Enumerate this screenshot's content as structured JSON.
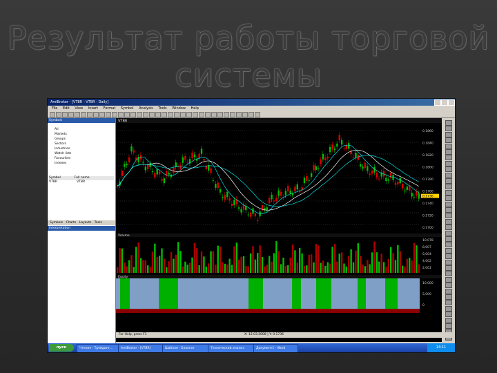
{
  "slide": {
    "title_line1": "Результат работы торговой",
    "title_line2": "системы"
  },
  "window": {
    "title": "AmiBroker - [VTBR - VTBR - Daily]",
    "menu": [
      "File",
      "Edit",
      "View",
      "Insert",
      "Format",
      "Symbol",
      "Analysis",
      "Tools",
      "Window",
      "Help"
    ]
  },
  "left_panel": {
    "header": "Symbols",
    "tree": [
      "All",
      "Markets",
      "Groups",
      "Sectors",
      "Industries",
      "Watch lists",
      "Favourites",
      "Indexes"
    ],
    "symbol_header": [
      "Symbol",
      "Full name"
    ],
    "symbol_row": [
      "VTBR",
      "VTBR"
    ],
    "tabs": [
      "Symbols",
      "Charts",
      "Layouts",
      "Tools"
    ],
    "lower_header": "Interpretation"
  },
  "chart": {
    "pane_label": "VTBR",
    "price_ticks": [
      "0.1860",
      "0.1840",
      "0.1820",
      "0.1800",
      "0.1780",
      "0.1760",
      "0.1740",
      "0.1720",
      "0.1700"
    ],
    "price_last": "0.1736",
    "volume_label": "Volume",
    "volume_ticks": [
      "10,078",
      "8,007",
      "6,004",
      "4,002",
      "2,001"
    ],
    "equity_label": "Equity",
    "equity_ticks": [
      "10,000",
      "5,000",
      "0"
    ],
    "colors": {
      "bull": "#00c000",
      "bear": "#e00000",
      "ma_fast": "#00e0e0",
      "ma_slow": "#ffffff",
      "equity_fill": "#7f9fc7",
      "signal": "#00b000"
    }
  },
  "status": {
    "text": "For Help, press F1",
    "coords": "X: 12.03.2008 | Y: 0.1736"
  },
  "taskbar": {
    "start": "пуск",
    "tasks": [
      "Чтение - Трейдинг...",
      "AmiBroker - [VTBR]",
      "Шаблон - Блокнот",
      "Технический анализ",
      "Документ1 - Word"
    ],
    "clock": "14:11"
  }
}
